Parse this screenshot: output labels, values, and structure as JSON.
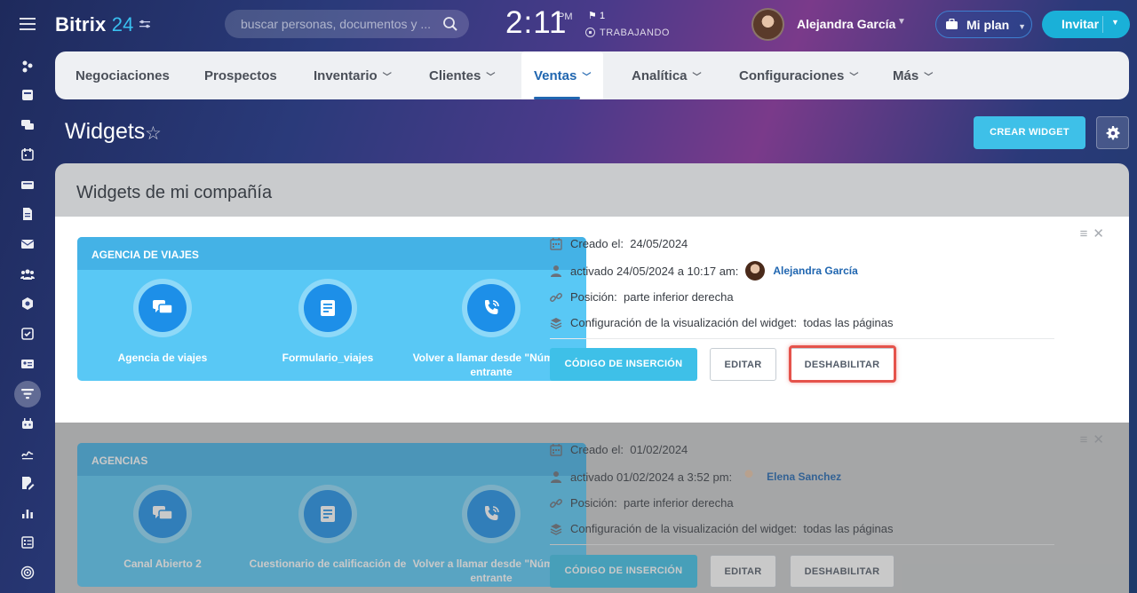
{
  "app": {
    "logo_text": "Bitrix",
    "logo_num": "24"
  },
  "header": {
    "search_placeholder": "buscar personas, documentos y ...",
    "clock_time": "2:11",
    "clock_ampm": "PM",
    "flag_count": "1",
    "work_status": "TRABAJANDO",
    "user_name": "Alejandra García",
    "plan_label": "Mi plan",
    "invite_label": "Invitar"
  },
  "menu": {
    "items": [
      {
        "label": "Negociaciones",
        "dropdown": false
      },
      {
        "label": "Prospectos",
        "dropdown": false
      },
      {
        "label": "Inventario",
        "dropdown": true
      },
      {
        "label": "Clientes",
        "dropdown": true
      },
      {
        "label": "Ventas",
        "dropdown": true,
        "active": true
      },
      {
        "label": "Analítica",
        "dropdown": true
      },
      {
        "label": "Configuraciones",
        "dropdown": true
      },
      {
        "label": "Más",
        "dropdown": true
      }
    ]
  },
  "page": {
    "title": "Widgets",
    "create_button": "CREAR WIDGET",
    "section_title": "Widgets de mi compañía"
  },
  "widgets": [
    {
      "name": "AGENCIA DE VIAJES",
      "items": [
        "Agencia de viajes",
        "Formulario_viajes",
        "Volver a llamar desde \"Número entrante"
      ],
      "created_label": "Creado el:",
      "created_date": "24/05/2024",
      "activated_text": "activado 24/05/2024 a 10:17 am:",
      "activated_user": "Alejandra García",
      "position_label": "Posición:",
      "position_value": "parte inferior derecha",
      "display_label": "Configuración de la visualización del widget:",
      "display_value": "todas las páginas",
      "code_button": "CÓDIGO DE INSERCIÓN",
      "edit_button": "EDITAR",
      "disable_button": "DESHABILITAR"
    },
    {
      "name": "AGENCIAS",
      "items": [
        "Canal Abierto 2",
        "Cuestionario de calificación de",
        "Volver a llamar desde \"Número entrante"
      ],
      "created_label": "Creado el:",
      "created_date": "01/02/2024",
      "activated_text": "activado 01/02/2024 a 3:52 pm:",
      "activated_user": "Elena Sanchez",
      "position_label": "Posición:",
      "position_value": "parte inferior derecha",
      "display_label": "Configuración de la visualización del widget:",
      "display_value": "todas las páginas",
      "code_button": "CÓDIGO DE INSERCIÓN",
      "edit_button": "EDITAR",
      "disable_button": "DESHABILITAR"
    }
  ],
  "colors": {
    "accent": "#3ec0e8",
    "link": "#2066b0",
    "highlight": "#e5534b"
  }
}
